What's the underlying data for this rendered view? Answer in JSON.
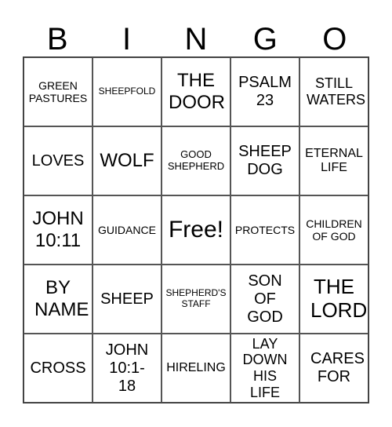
{
  "header": [
    "B",
    "I",
    "N",
    "G",
    "O"
  ],
  "cells": [
    [
      "GREEN PASTURES",
      "SHEEPFOLD",
      "THE DOOR",
      "PSALM 23",
      "STILL WATERS"
    ],
    [
      "LOVES",
      "WOLF",
      "GOOD SHEPHERD",
      "SHEEP DOG",
      "ETERNAL LIFE"
    ],
    [
      "JOHN 10:11",
      "GUIDANCE",
      "Free!",
      "PROTECTS",
      "CHILDREN OF GOD"
    ],
    [
      "BY NAME",
      "SHEEP",
      "SHEPHERD'S STAFF",
      "SON OF GOD",
      "THE LORD"
    ],
    [
      "CROSS",
      "JOHN 10:1-18",
      "HIRELING",
      "LAY DOWN HIS LIFE",
      "CARES FOR"
    ]
  ]
}
